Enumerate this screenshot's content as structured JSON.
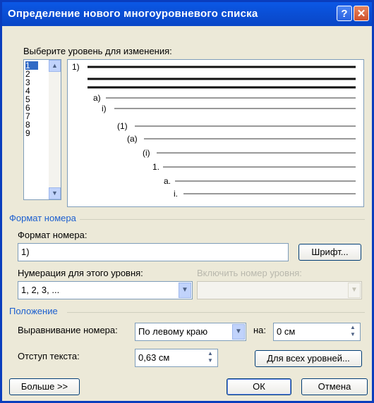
{
  "window": {
    "title": "Определение нового многоуровневого списка"
  },
  "titlebar": {
    "help_label": "?",
    "close_label": "✕"
  },
  "level_select": {
    "label": "Выберите уровень для изменения:",
    "levels": [
      "1",
      "2",
      "3",
      "4",
      "5",
      "6",
      "7",
      "8",
      "9"
    ],
    "selected": "1"
  },
  "preview": {
    "labels": [
      "1)",
      "а)",
      "i)",
      "(1)",
      "(а)",
      "(i)",
      "1.",
      "а.",
      "i."
    ]
  },
  "number_format": {
    "section_title": "Формат номера",
    "format_label": "Формат номера:",
    "format_value": "1)",
    "font_button": "Шрифт...",
    "numbering_label": "Нумерация для этого уровня:",
    "numbering_value": "1, 2, 3, ...",
    "include_label": "Включить номер уровня:",
    "include_value": ""
  },
  "position": {
    "section_title": "Положение",
    "alignment_label": "Выравнивание номера:",
    "alignment_value": "По левому краю",
    "at_label": "на:",
    "at_value": "0 см",
    "indent_label": "Отступ текста:",
    "indent_value": "0,63 см",
    "all_levels_button": "Для всех уровней..."
  },
  "footer": {
    "more_button": "Больше >>",
    "ok_button": "ОК",
    "cancel_button": "Отмена"
  },
  "icons": {
    "help": "help-icon",
    "close": "close-icon",
    "dropdown": "chevron-down-icon",
    "spin": "spin-arrows-icon"
  }
}
